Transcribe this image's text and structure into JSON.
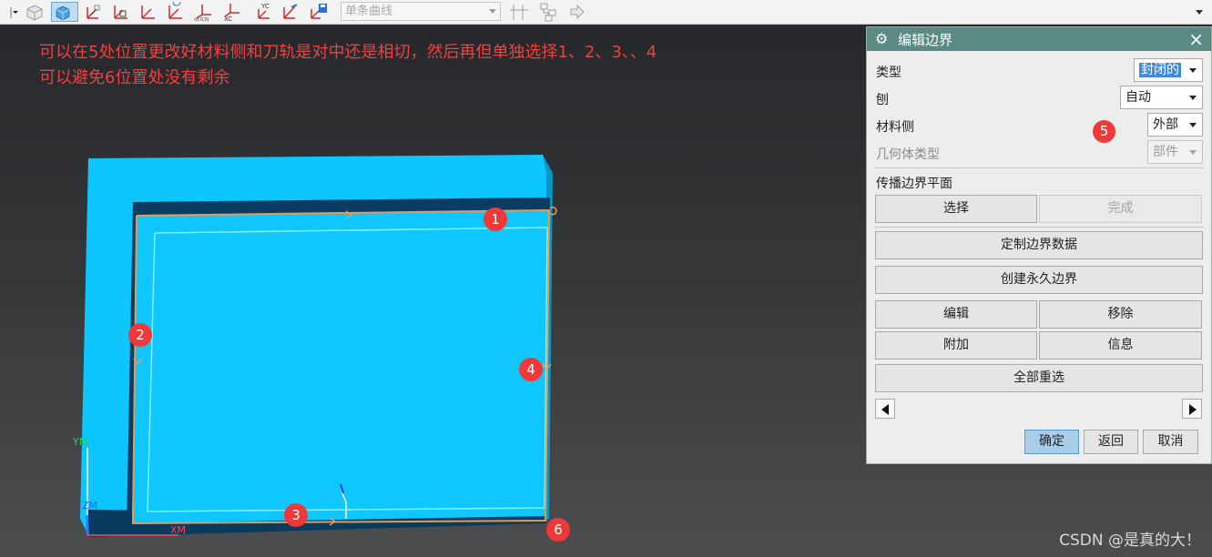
{
  "toolbar": {
    "curve_rule_value": "单条曲线",
    "icons": [
      "dropdown-arrow-icon",
      "shaded-view-icon",
      "wcs-icon",
      "axis-icon-1",
      "axis-icon-2",
      "axis-icon-3",
      "axis-icon-4",
      "wcs-origin-icon",
      "xc-axis-icon",
      "yc-axis-icon",
      "axis-icon-5",
      "save-view-icon",
      "junction-icon",
      "tree-icon",
      "forward-arrow-icon"
    ]
  },
  "viewport": {
    "annotation_line1": "可以在5处位置更改好材料侧和刀轨是对中还是相切，然后再但单独选择1、2、3、、4",
    "annotation_line2": "可以避免6位置处没有剩余",
    "markers": [
      "1",
      "2",
      "3",
      "4",
      "5",
      "6"
    ],
    "axis_labels": {
      "ym": "YM",
      "zm": "ZM",
      "xm": "XM"
    },
    "watermark": "CSDN @是真的大！",
    "colors": {
      "part": "#0fc6ff",
      "edge": "#e89a55",
      "annotation": "#f1403f",
      "marker": "#ef3838"
    }
  },
  "dialog": {
    "title": "编辑边界",
    "type_label": "类型",
    "type_value": "封闭的",
    "plane_label": "刨",
    "plane_value": "自动",
    "material_side_label": "材料侧",
    "material_side_value": "外部",
    "geometry_type_label": "几何体类型",
    "geometry_type_value": "部件",
    "propagate_label": "传播边界平面",
    "select_button": "选择",
    "finish_button": "完成",
    "custom_data_button": "定制边界数据",
    "create_permanent_button": "创建永久边界",
    "edit_button": "编辑",
    "remove_button": "移除",
    "append_button": "附加",
    "info_button": "信息",
    "reselect_all_button": "全部重选",
    "ok_button": "确定",
    "back_button": "返回",
    "cancel_button": "取消"
  }
}
